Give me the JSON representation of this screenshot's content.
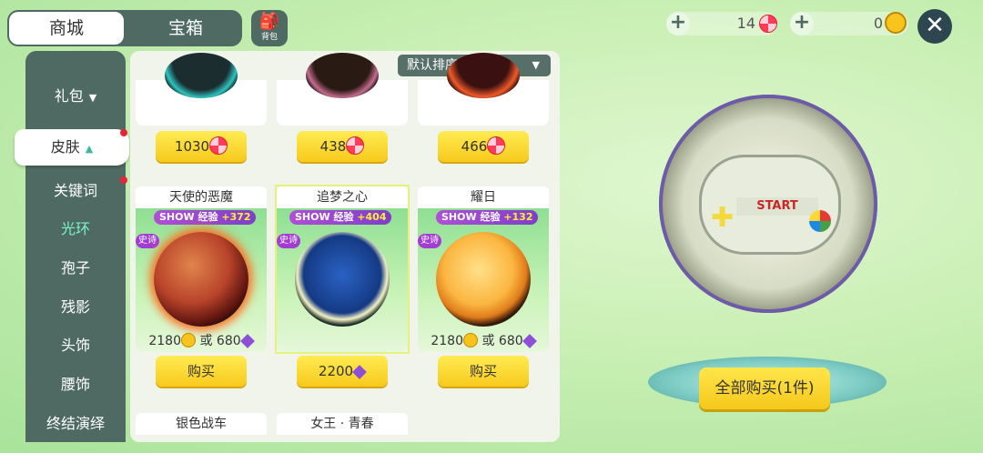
{
  "top_tabs": [
    "商城",
    "宝箱"
  ],
  "bag_label": "背包",
  "sidebar": {
    "items": [
      "礼包",
      "皮肤",
      "关键词",
      "光环",
      "孢子",
      "残影",
      "头饰",
      "腰饰",
      "终结演绎"
    ]
  },
  "sort": {
    "label": "默认排序"
  },
  "top_prices": [
    "1030",
    "438",
    "466"
  ],
  "items": [
    {
      "name": "天使的恶魔",
      "show_label": "SHOW 经验",
      "exp": "+372",
      "epic": "史诗",
      "coin_price": "2180",
      "or": "或",
      "gem_price": "680",
      "button": "购买"
    },
    {
      "name": "追梦之心",
      "show_label": "SHOW 经验",
      "exp": "+404",
      "epic": "史诗",
      "button_price": "2200"
    },
    {
      "name": "耀日",
      "show_label": "SHOW 经验",
      "exp": "+132",
      "epic": "史诗",
      "coin_price": "2180",
      "or": "或",
      "gem_price": "680",
      "button": "购买"
    }
  ],
  "bottom_names": [
    "银色战车",
    "女王 · 青春"
  ],
  "currency": {
    "candy": "14",
    "coin": "0"
  },
  "preview_screen_text": "START",
  "buy_all": "全部购买(1件)",
  "colors": {
    "panel_dark": "#4f6a63",
    "button_yellow": "#f7c91c",
    "accent_green": "#7cf4c6",
    "epic_purple": "#a23dd3"
  }
}
